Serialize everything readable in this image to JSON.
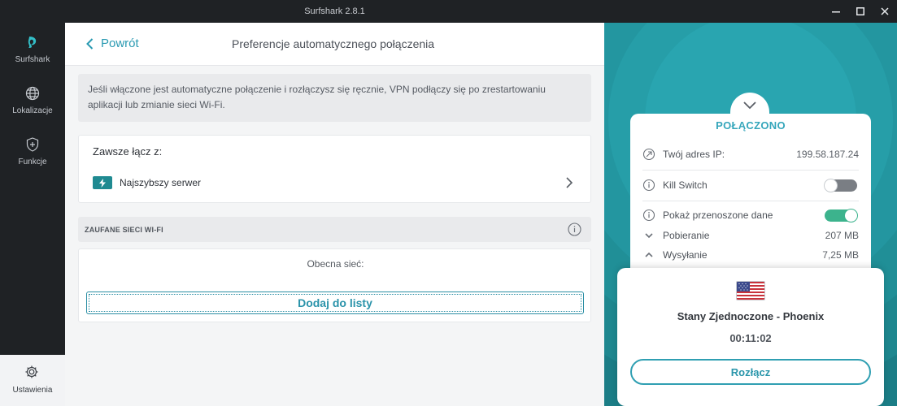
{
  "window": {
    "title": "Surfshark 2.8.1",
    "controls": {
      "minimize": "—",
      "maximize": "☐",
      "close": "✕"
    }
  },
  "nav": {
    "items": [
      {
        "label": "Surfshark",
        "icon": "surfshark-logo-icon",
        "active": true
      },
      {
        "label": "Lokalizacje",
        "icon": "globe-icon"
      },
      {
        "label": "Funkcje",
        "icon": "shield-plus-icon"
      }
    ],
    "settings": {
      "label": "Ustawienia",
      "icon": "gear-icon"
    }
  },
  "main": {
    "back_label": "Powrót",
    "title": "Preferencje automatycznego połączenia",
    "info_text": "Jeśli włączone jest automatyczne połączenie i rozłączysz się ręcznie, VPN podłączy się po zrestartowaniu aplikacji lub zmianie sieci Wi-Fi.",
    "always_connect": {
      "title": "Zawsze łącz z:",
      "server": "Najszybszy serwer"
    },
    "trusted_wifi": {
      "header": "ZAUFANE SIECI WI-FI",
      "current_network": "Obecna sieć:",
      "add_button": "Dodaj do listy"
    }
  },
  "status_panel": {
    "status": "POŁĄCZONO",
    "ip_label": "Twój adres IP:",
    "ip_value": "199.58.187.24",
    "kill_switch_label": "Kill Switch",
    "kill_switch_on": false,
    "show_data_label": "Pokaż przenoszone dane",
    "show_data_on": true,
    "download_label": "Pobieranie",
    "download_value": "207 MB",
    "upload_label": "Wysyłanie",
    "upload_value": "7,25 MB"
  },
  "location": {
    "country": "Stany Zjednoczone - Phoenix",
    "timer": "00:11:02",
    "disconnect_label": "Rozłącz"
  },
  "colors": {
    "accent": "#2a9ab2",
    "teal_bg": "#1b7d86",
    "nav_bg": "#1f2225",
    "toggle_on": "#3cb38d"
  }
}
